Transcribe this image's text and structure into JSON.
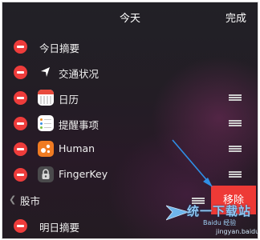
{
  "header": {
    "title": "今天",
    "done_label": "完成"
  },
  "items": [
    {
      "label": "今日摘要"
    },
    {
      "label": "交通状况"
    },
    {
      "label": "日历"
    },
    {
      "label": "提醒事项"
    },
    {
      "label": "Human"
    },
    {
      "label": "FingerKey"
    }
  ],
  "section": {
    "label": "股市"
  },
  "bottom_item": {
    "label": "明日摘要"
  },
  "delete_label": "移除",
  "watermark": {
    "brand": "统一下载站",
    "sub": "Baidu 经验",
    "url": "jingyan.baidu.com"
  },
  "colors": {
    "remove_red": "#ee3c3b",
    "delete_red": "#ee3a36",
    "calendar_band": "#e84a3c",
    "human_orange": "#f07b22",
    "annotation_arrow": "#2f8fe6"
  }
}
